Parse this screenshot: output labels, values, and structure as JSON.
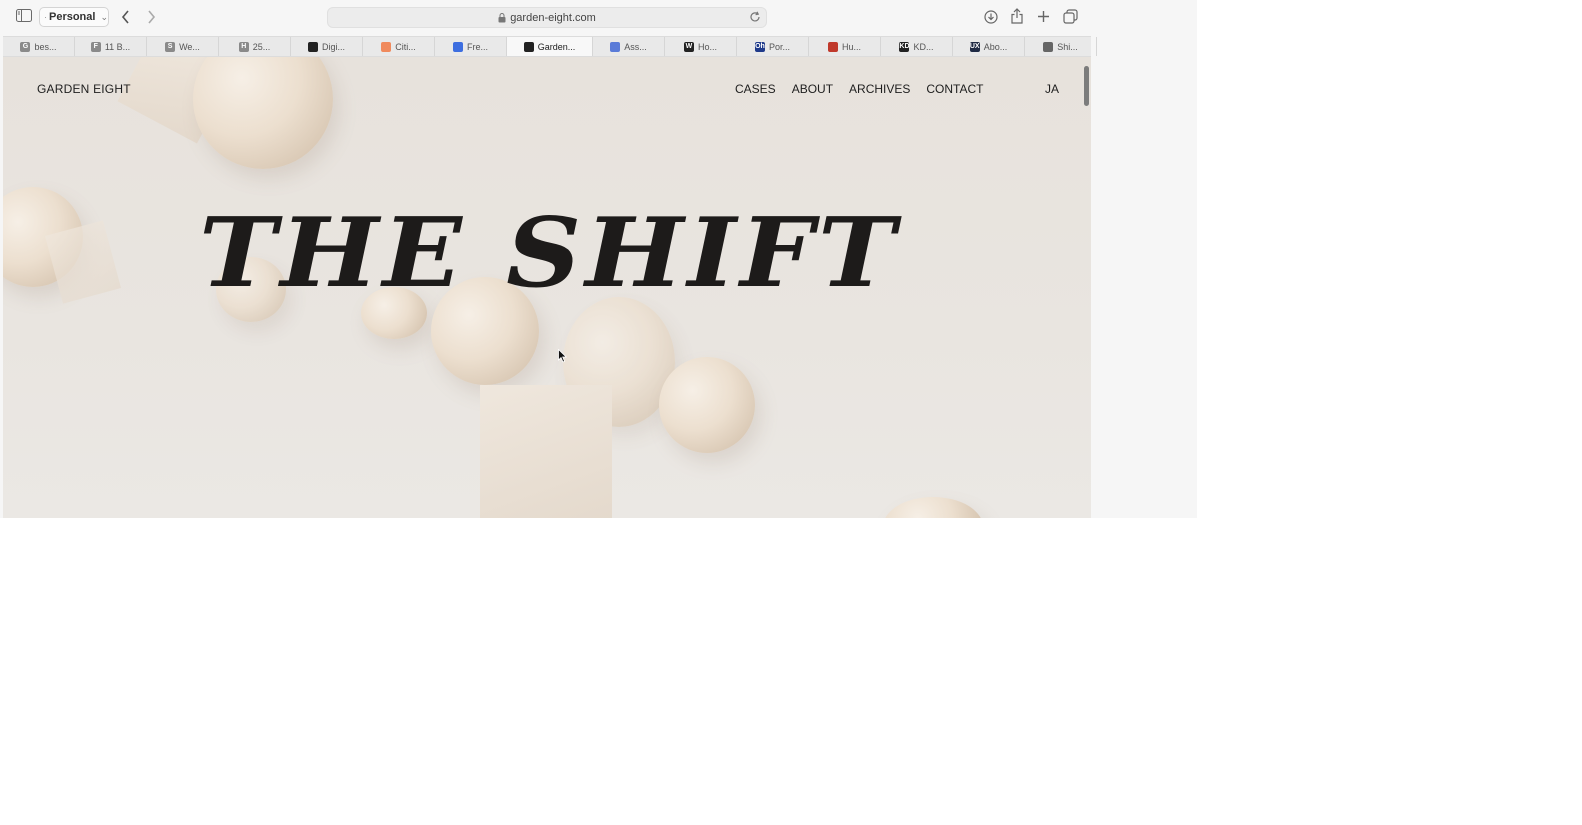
{
  "browser": {
    "profile_label": "Personal",
    "url": "garden-eight.com",
    "tabs": [
      {
        "label": "bes...",
        "favicon": "G",
        "color": "#8a8a8a",
        "active": false
      },
      {
        "label": "11 B...",
        "favicon": "F",
        "color": "#8a8a8a",
        "active": false
      },
      {
        "label": "We...",
        "favicon": "S",
        "color": "#8a8a8a",
        "active": false
      },
      {
        "label": "25...",
        "favicon": "H",
        "color": "#8a8a8a",
        "active": false
      },
      {
        "label": "Digi...",
        "favicon": "",
        "color": "#222222",
        "active": false
      },
      {
        "label": "Citi...",
        "favicon": "",
        "color": "#f08a5d",
        "active": false
      },
      {
        "label": "Fre...",
        "favicon": "",
        "color": "#3d6ee0",
        "active": false
      },
      {
        "label": "Garden...",
        "favicon": "",
        "color": "#222222",
        "active": true
      },
      {
        "label": "Ass...",
        "favicon": "",
        "color": "#5a7bd8",
        "active": false
      },
      {
        "label": "Ho...",
        "favicon": "W",
        "color": "#222222",
        "active": false
      },
      {
        "label": "Por...",
        "favicon": "Oh",
        "color": "#1f3a8a",
        "active": false
      },
      {
        "label": "Hu...",
        "favicon": "",
        "color": "#c0392b",
        "active": false
      },
      {
        "label": "KD...",
        "favicon": "KD",
        "color": "#222222",
        "active": false
      },
      {
        "label": "Abo...",
        "favicon": "UX",
        "color": "#1f2a44",
        "active": false
      },
      {
        "label": "Shi...",
        "favicon": "",
        "color": "#666666",
        "active": false
      }
    ]
  },
  "site": {
    "logo": "GARDEN EIGHT",
    "nav": [
      "CASES",
      "ABOUT",
      "ARCHIVES",
      "CONTACT"
    ],
    "language": "JA",
    "hero_title": "THE SHIFT"
  },
  "colors": {
    "background": "#e8e3dd",
    "text": "#1e1e1e",
    "sphere": "#ecdfcf"
  }
}
